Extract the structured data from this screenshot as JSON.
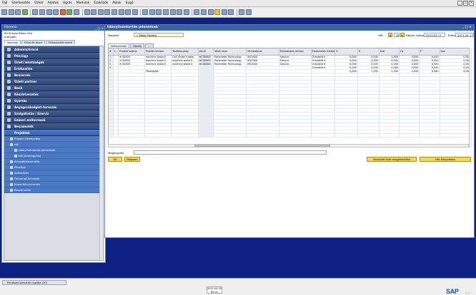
{
  "menu": [
    "Fájl",
    "Szerkesztés",
    "Üzleti",
    "Adatok",
    "Ugrás",
    "Modulok",
    "Eszközök",
    "Ablak",
    "Súgó"
  ],
  "left_panel": {
    "title": "Főmenü",
    "company": "Bli Simple Bikes USA",
    "user": "manager",
    "tabs": [
      "Modulok",
      "Húzd és Hozd",
      "Felhasználói menü"
    ],
    "modules": [
      "Adminisztráció",
      "Pénzügy",
      "Üzleti lehetőségek",
      "Értékesítés",
      "Beszerzés",
      "Üzleti partner",
      "Bank",
      "Készletvezetés",
      "Gyártás",
      "Anyagszükséglet-tervezés",
      "Szolgáltatás / Szerviz",
      "Emberi erőforrások",
      "Beszámolók"
    ],
    "active_module": "Projektek",
    "sub_items": [
      {
        "label": "Projekt létrehozása",
        "indent": 1
      },
      {
        "label": "Idő",
        "indent": 1
      },
      {
        "label": "Időnyilvántartás jelentések",
        "indent": 2
      },
      {
        "label": "Idő jóváhagyása",
        "indent": 2
      },
      {
        "label": "Anyagfelhasználás",
        "indent": 1
      },
      {
        "label": "Pénzügy",
        "indent": 1
      },
      {
        "label": "Számlázás",
        "indent": 1
      },
      {
        "label": "Folyamat-tervezés",
        "indent": 1
      },
      {
        "label": "Kapacitás-tervezés",
        "indent": 1
      },
      {
        "label": "Beszámolók",
        "indent": 1
      }
    ]
  },
  "main": {
    "title": "Időnyilvántartás jelentések",
    "employee_label": "Dolgozó",
    "employee_value": "Fábio Pizzato",
    "week_label": "Hét",
    "week_value": "16",
    "date_from_label": "Dátum időszak",
    "date_from_value": "2011.04.11",
    "date_to_label": "Eddig",
    "date_to_value": "2011.04.17",
    "tabs": [
      "Időbevitelek",
      "Utazás",
      "..."
    ],
    "columns": [
      "#",
      "I...",
      "Projekt száma",
      "Projekt leírása",
      "Tevékenység",
      "Vev.K",
      "Vevő neve",
      "Munkatípus",
      "Munkatípus leírása",
      "Elszámolás módja",
      "H",
      "K",
      "Sze",
      "Cs",
      "P",
      "Szo"
    ],
    "rows": [
      {
        "n": "1",
        "proj": "S0000",
        "desc": "machine broke II",
        "act": "Call /Order intake",
        "cust": "C30000",
        "cname": "Parameter Technology",
        "wt": "M10004",
        "wtd": "Service",
        "bill": "Óránként",
        "h": "0,000",
        "k": "0,000",
        "sze": "2,000",
        "cs": "0,000",
        "p": "0,000",
        "szo": "0,000"
      },
      {
        "n": "2",
        "proj": "S0000",
        "desc": "machine broke II",
        "act": "machine broke II",
        "cust": "C30000",
        "cname": "Parameter Technology",
        "wt": "M10004",
        "wtd": "Service",
        "bill": "Óránként",
        "h": "0,000",
        "k": "4,000",
        "sze": "0,000",
        "cs": "0,000",
        "p": "0,000",
        "szo": "0,000"
      },
      {
        "n": "3",
        "proj": "S0000",
        "desc": "machine broke II",
        "act": "machine broke II",
        "cust": "C30000",
        "cname": "Parameter Technology",
        "wt": "M10004",
        "wtd": "Service",
        "bill": "Óránként",
        "h": "0,000",
        "k": "3,000",
        "sze": "0,000",
        "cs": "0,000",
        "p": "0,000",
        "szo": "0,000"
      },
      {
        "n": "4",
        "proj": "",
        "desc": "",
        "act": "",
        "cust": "",
        "cname": "",
        "wt": "",
        "wtd": "",
        "bill": "Óránként",
        "h": "0,000",
        "k": "0,000",
        "sze": "0,000",
        "cs": "0,000",
        "p": "0,000",
        "szo": "0,000"
      }
    ],
    "total_label": "Összegzés",
    "totals": {
      "h": "0,000",
      "k": "7,000",
      "sze": "2,000",
      "cs": "0,000",
      "p": "0,000",
      "szo": "0,000"
    },
    "remarks_label": "Megjegyzés",
    "ok_label": "OK",
    "cancel_label": "Mégsem",
    "btn_plan": "Tervezett órák megjelenítése",
    "btn_ledger": "Hét könyvelése"
  },
  "taskbar": {
    "tab": "Rendszerüzenetek naplója (20)",
    "date": "2011.04.22",
    "time": "09:41"
  },
  "brand": {
    "logo": "SAP",
    "sub": "One"
  }
}
